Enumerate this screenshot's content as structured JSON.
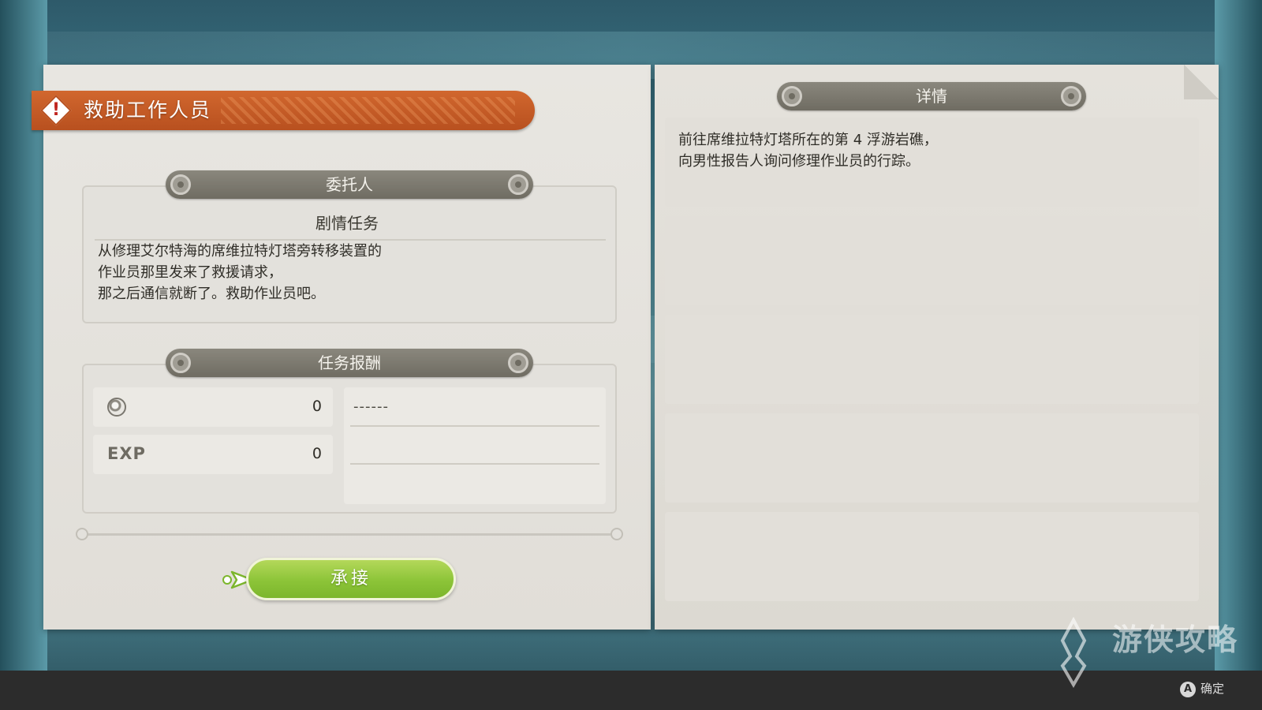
{
  "quest": {
    "title": "救助工作人员",
    "title_icon": "warning-diamond-icon"
  },
  "client": {
    "header": "委托人",
    "type": "剧情任务",
    "description_lines": [
      "从修理艾尔特海的席维拉特灯塔旁转移装置的",
      "作业员那里发来了救援请求，",
      "那之后通信就断了。救助作业员吧。"
    ]
  },
  "rewards": {
    "header": "任务报酬",
    "currency_icon": "coin-icon",
    "currency_value": "0",
    "exp_label": "EXP",
    "exp_value": "0",
    "item": "------"
  },
  "accept_button": "承接",
  "details": {
    "header": "详情",
    "lines": [
      "前往席维拉特灯塔所在的第 4 浮游岩礁，",
      "向男性报告人询问修理作业员的行踪。"
    ]
  },
  "footer": {
    "a_button": "A",
    "confirm_label": "确定"
  },
  "watermark": "游侠攻略",
  "colors": {
    "banner": "#c95d27",
    "accept": "#8cc438",
    "header_bar": "#7a776d"
  }
}
